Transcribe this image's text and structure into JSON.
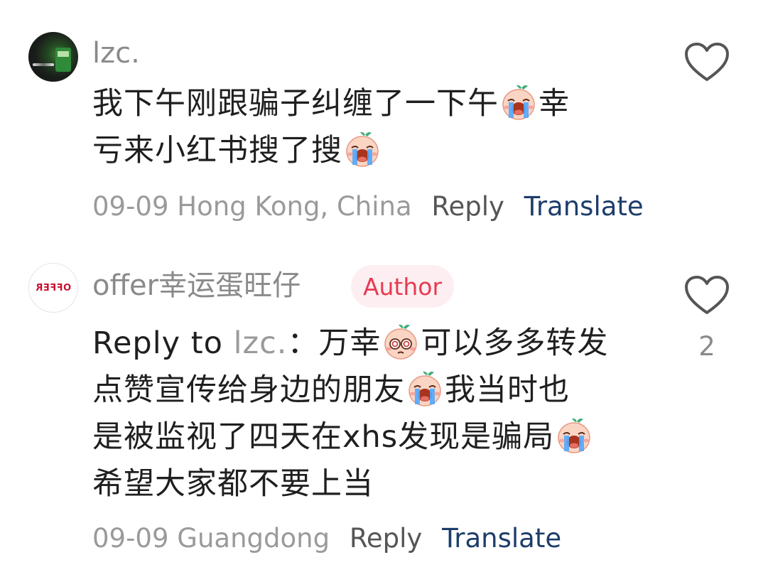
{
  "comments": [
    {
      "username": "lzc.",
      "text_line1": "我下午刚跟骗子纠缠了一下午",
      "text_line1b": "幸",
      "text_line2": "亏来小红书搜了搜",
      "date": "09-09",
      "location": "Hong Kong, China",
      "reply_label": "Reply",
      "translate_label": "Translate",
      "like_count": "",
      "avatar_icon": "profile-photo"
    },
    {
      "username": "offer幸运蛋旺仔",
      "author_badge": "Author",
      "avatar_text": "OFFER",
      "reply_to_label": "Reply to",
      "mention": "lzc.",
      "text_a": "：万幸",
      "text_b": "可以多多转发",
      "text_c": "点赞宣传给身边的朋友",
      "text_d": "我当时也",
      "text_e": "是被监视了四天在xhs发现是骗局",
      "text_f": "希望大家都不要上当",
      "date": "09-09",
      "location": "Guangdong",
      "reply_label": "Reply",
      "translate_label": "Translate",
      "like_count": "2"
    }
  ],
  "colors": {
    "author_badge_bg": "#fdeff1",
    "author_badge_text": "#e83a52",
    "translate_link": "#1d3d6b",
    "meta_gray": "#9a9a9a"
  },
  "icons": [
    "heart-outline-icon",
    "crying-emoji",
    "pleading-emoji"
  ]
}
